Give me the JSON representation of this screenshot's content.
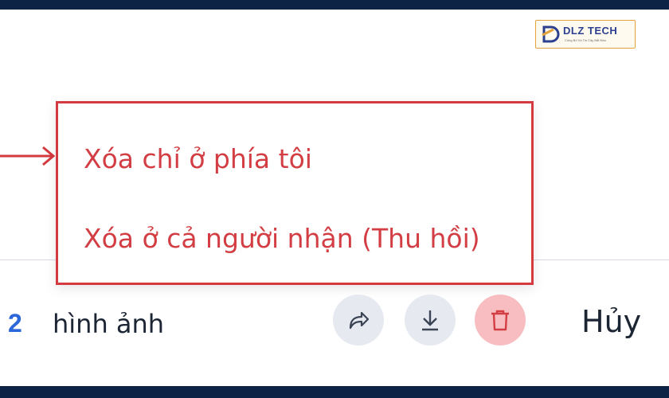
{
  "logo": {
    "brand": "DLZ TECH",
    "tagline": "Công Bố Và Tin Cậy Bắt Đầu"
  },
  "menu": {
    "items": [
      {
        "label": "Xóa chỉ ở phía tôi"
      },
      {
        "label": "Xóa ở cả người nhận (Thu hồi)"
      }
    ]
  },
  "selection": {
    "count": "2",
    "label": "hình ảnh"
  },
  "actions": {
    "share_icon": "share-icon",
    "download_icon": "download-icon",
    "delete_icon": "trash-icon"
  },
  "cancel_label": "Hủy",
  "colors": {
    "menu_text": "#d23e43",
    "menu_border": "#d43a3f",
    "count_accent": "#2b67d8",
    "delete_bg": "#f7bdc0",
    "action_bg": "#e6eaf0"
  }
}
